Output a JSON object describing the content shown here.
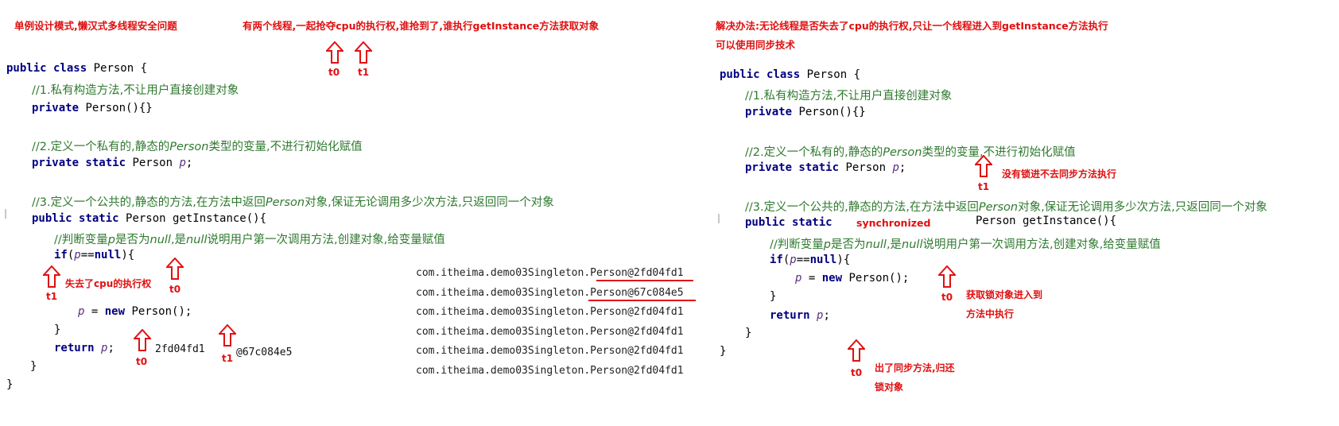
{
  "left": {
    "title_note": "单例设计模式,懒汉式多线程安全问题",
    "race_note": "有两个线程,一起抢夺cpu的执行权,谁抢到了,谁执行getInstance方法获取对象",
    "code": {
      "class_kw": "public class",
      "class_name": "Person {",
      "comment1": "//1.私有构造方法,不让用户直接创建对象",
      "ctor_kw": "private",
      "ctor_rest": "Person(){}",
      "comment2a": "//2.定义一个私有的,静态的",
      "comment2b": "Person",
      "comment2c": "类型的变量,不进行初始化赋值",
      "field_kw": "private static",
      "field_type": "Person",
      "field_var": "p",
      "field_end": ";",
      "comment3a": "//3.定义一个公共的,静态的方法,在方法中返回",
      "comment3b": "Person",
      "comment3c": "对象,保证无论调用多少次方法,只返回同一个对象",
      "method_kw": "public static",
      "method_rest": "Person getInstance(){",
      "comment4a": "//判断变量",
      "comment4b": "p",
      "comment4c": "是否为",
      "comment4d": "null",
      "comment4e": ",是",
      "comment4f": "null",
      "comment4g": "说明用户第一次调用方法,创建对象,给变量赋值",
      "if_kw": "if",
      "if_open": "(",
      "if_var": "p",
      "if_op": "==",
      "if_null": "null",
      "if_close": "){",
      "assign_var": "p",
      "assign_op": " = ",
      "assign_new": "new",
      "assign_rest": " Person();",
      "if_end": "}",
      "return_kw": "return",
      "return_var": "p",
      "return_end": ";",
      "method_end": "}",
      "class_end": "}"
    },
    "frag1": "2fd04fd1",
    "frag2": "@67c084e5",
    "arrows": {
      "t0_top": "t0",
      "t1_top": "t1",
      "lost_cpu": "失去了cpu的执行权",
      "t1_if": "t1",
      "t0_if": "t0",
      "t0_ret": "t0",
      "t1_ret": "t1"
    },
    "output": {
      "prefix": "com.itheima.demo03Singleton.",
      "lines": [
        "Person@2fd04fd1",
        "Person@67c084e5",
        "Person@2fd04fd1",
        "Person@2fd04fd1",
        "Person@2fd04fd1",
        "Person@2fd04fd1"
      ]
    }
  },
  "right": {
    "solution_note1": "解决办法:无论线程是否失去了cpu的执行权,只让一个线程进入到getInstance方法执行",
    "solution_note2": "可以使用同步技术",
    "code": {
      "class_kw": "public class",
      "class_name": "Person {",
      "comment1": "//1.私有构造方法,不让用户直接创建对象",
      "ctor_kw": "private",
      "ctor_rest": "Person(){}",
      "comment2a": "//2.定义一个私有的,静态的",
      "comment2b": "Person",
      "comment2c": "类型的变量,不进行初始化赋值",
      "field_kw": "private static",
      "field_type": "Person",
      "field_var": "p",
      "field_end": ";",
      "comment3a": "//3.定义一个公共的,静态的方法,在方法中返回",
      "comment3b": "Person",
      "comment3c": "对象,保证无论调用多少次方法,只返回同一个对象",
      "method_kw": "public static",
      "synchronized": "synchronized",
      "method_rest": "Person getInstance(){",
      "comment4a": "//判断变量",
      "comment4b": "p",
      "comment4c": "是否为",
      "comment4d": "null",
      "comment4e": ",是",
      "comment4f": "null",
      "comment4g": "说明用户第一次调用方法,创建对象,给变量赋值",
      "if_kw": "if",
      "if_open": "(",
      "if_var": "p",
      "if_op": "==",
      "if_null": "null",
      "if_close": "){",
      "assign_var": "p",
      "assign_op": " = ",
      "assign_new": "new",
      "assign_rest": " Person();",
      "if_end": "}",
      "return_kw": "return",
      "return_var": "p",
      "return_end": ";",
      "method_end": "}",
      "class_end": "}"
    },
    "arrows": {
      "t1_field": "t1",
      "no_lock": "没有锁进不去同步方法执行",
      "t0_if": "t0",
      "got_lock1": "获取锁对象进入到",
      "got_lock2": "方法中执行",
      "t0_ret": "t0",
      "release1": "出了同步方法,归还",
      "release2": "锁对象"
    }
  }
}
